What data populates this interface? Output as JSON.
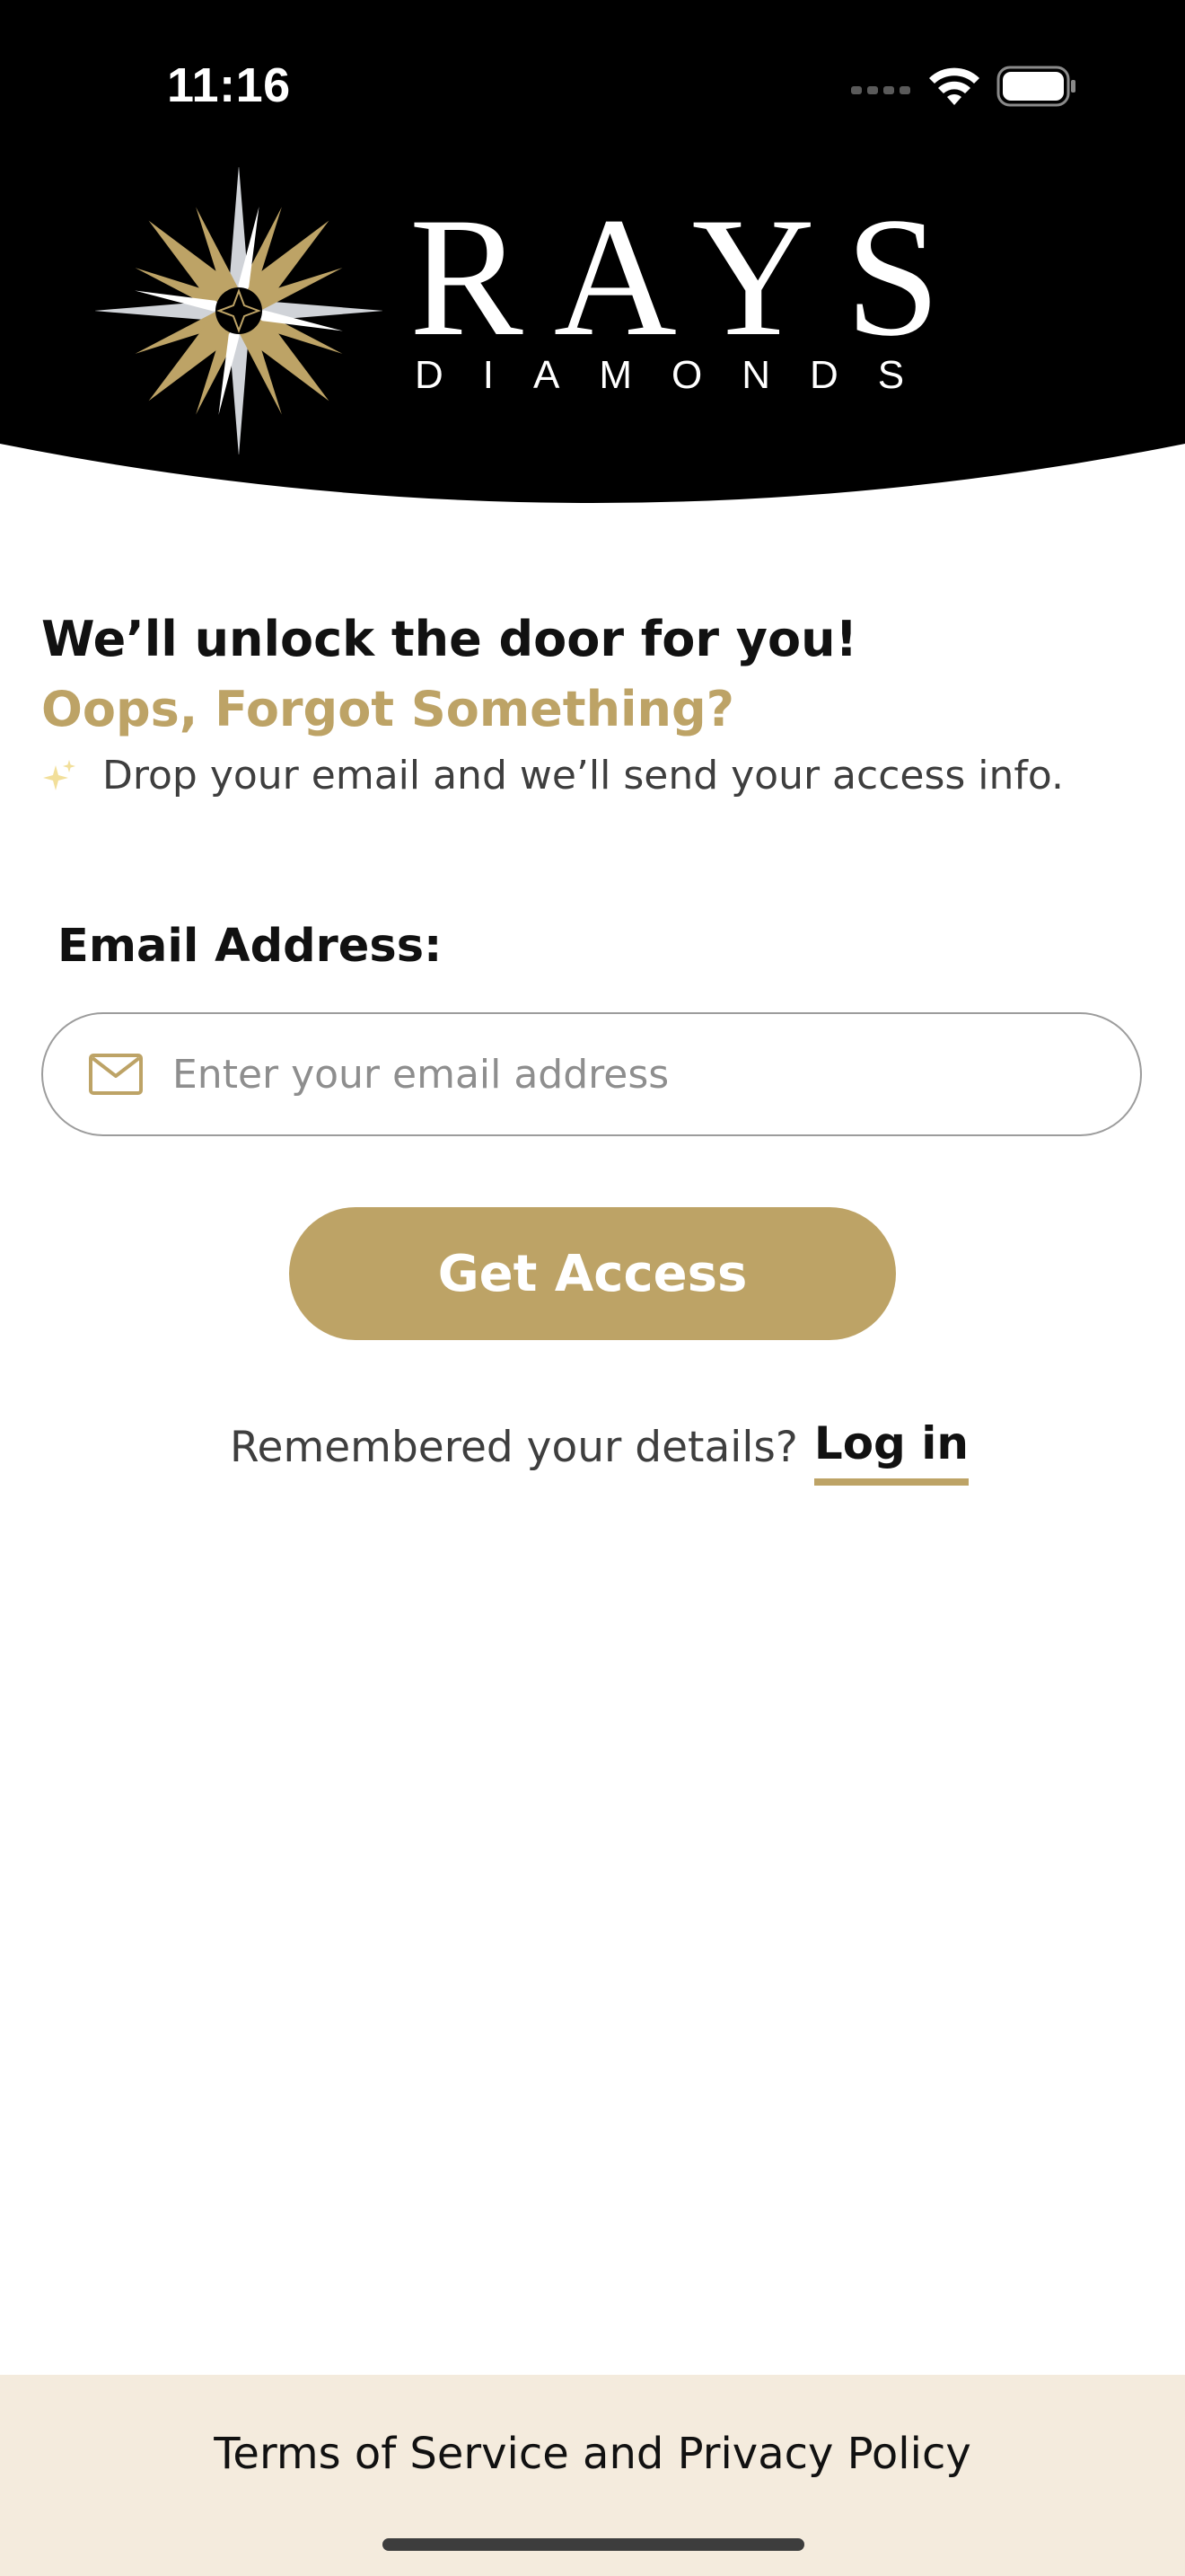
{
  "status_bar": {
    "time": "11:16",
    "icons": [
      "signal-icon",
      "wifi-icon",
      "battery-icon"
    ]
  },
  "brand": {
    "name": "RAYS",
    "subname": "DIAMONDS",
    "colors": {
      "gold": "#bda366",
      "silver": "#d0d3d8",
      "black": "#000000"
    }
  },
  "intro": {
    "heading": "We’ll unlock the door for you!",
    "subheading": "Oops, Forgot Something?",
    "info_icon": "sparkle-icon",
    "info_text": "Drop your email and we’ll send your access info."
  },
  "form": {
    "email_label": "Email Address:",
    "email_icon": "mail-icon",
    "email_placeholder": "Enter your email address",
    "email_value": "",
    "submit_label": "Get Access"
  },
  "login": {
    "prompt": "Remembered your details?",
    "link_label": "Log in"
  },
  "footer": {
    "link_label": "Terms of Service and Privacy Policy",
    "background": "#f4ebdd"
  },
  "theme": {
    "accent": "#bda366",
    "text_dark": "#111111",
    "text_muted": "#3e3e3e"
  }
}
